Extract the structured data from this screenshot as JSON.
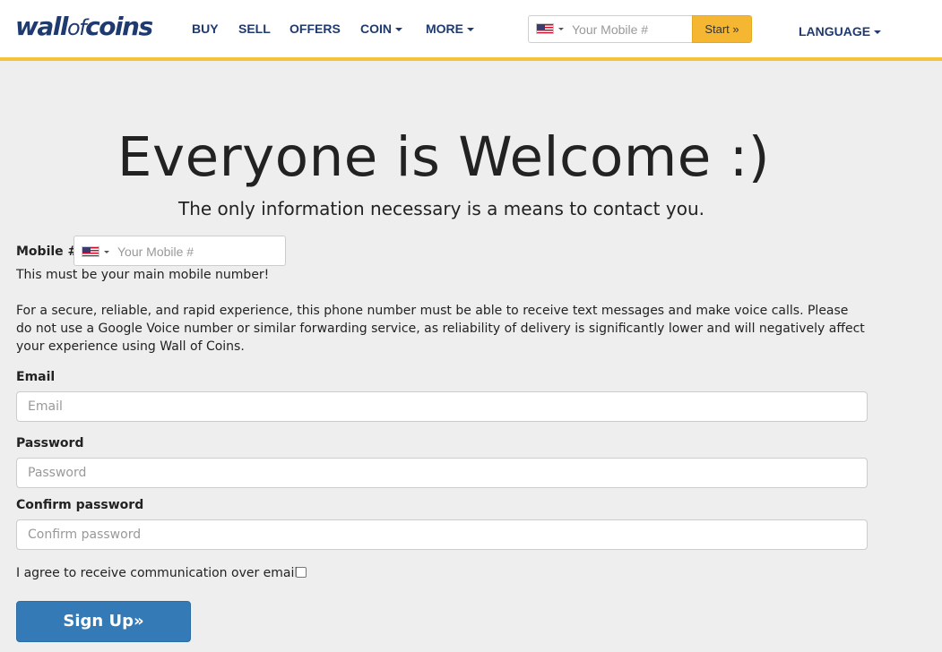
{
  "header": {
    "logo_wall": "wall",
    "logo_of": "of",
    "logo_coins": "coins",
    "nav": {
      "buy": "BUY",
      "sell": "SELL",
      "offers": "OFFERS",
      "coin": "COIN",
      "more": "MORE",
      "language": "LANGUAGE"
    },
    "phone_placeholder": "Your Mobile #",
    "start_button": "Start »"
  },
  "hero": {
    "title": "Everyone is Welcome :)",
    "subtitle": "The only information necessary is a means to contact you."
  },
  "form": {
    "mobile_label": "Mobile #",
    "mobile_placeholder": "Your Mobile #",
    "mobile_note": "This must be your main mobile number!",
    "mobile_desc": "For a secure, reliable, and rapid experience, this phone number must be able to receive text messages and make voice calls. Please do not use a Google Voice number or similar forwarding service, as reliability of delivery is significantly lower and will negatively affect your experience using Wall of Coins.",
    "email_label": "Email",
    "email_placeholder": "Email",
    "password_label": "Password",
    "password_placeholder": "Password",
    "confirm_label": "Confirm password",
    "confirm_placeholder": "Confirm password",
    "agree_label": "I agree to receive communication over email",
    "agree_checked": false,
    "signup_button": "Sign Up»"
  },
  "colors": {
    "brand_navy": "#1f3a6e",
    "accent_yellow": "#f5c33b",
    "primary_blue": "#337ab7",
    "page_bg": "#eeeeee"
  },
  "icons": [
    "us-flag-icon",
    "caret-down-icon"
  ]
}
